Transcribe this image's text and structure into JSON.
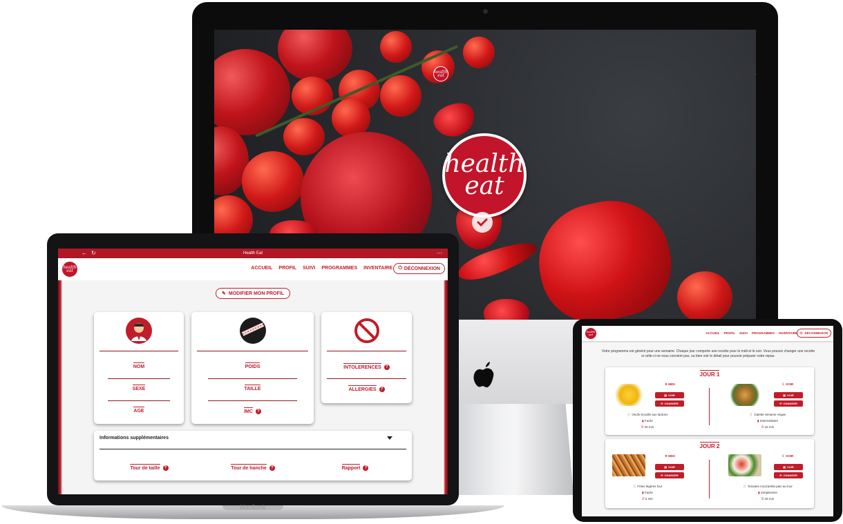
{
  "brand": {
    "logo_line1": "health",
    "logo_line2": "eat",
    "accent": "#c11c2a"
  },
  "nav": {
    "items": [
      "ACCUEIL",
      "PROFIL",
      "SUIVI",
      "PROGRAMMES",
      "INVENTAIRE"
    ],
    "logout_label": "DÉCONNEXION"
  },
  "macbook": {
    "window_title": "Health Eat",
    "brand_label": "MacBook",
    "edit_profile_label": "MODIFIER MON PROFIL",
    "identity_fields": [
      "NOM",
      "SEXE",
      "AGE"
    ],
    "body_fields": [
      "POIDS",
      "TAILLE",
      "IMC"
    ],
    "diet_fields": [
      "INTOLERENCES",
      "ALLERGIES"
    ],
    "extra_title": "Informations supplémentaires",
    "extra_fields": [
      "Tour de taille",
      "Tour de hanche",
      "Rapport"
    ],
    "help_icon": "?"
  },
  "ipad": {
    "intro": "Votre programme est généré pour une semaine. Chaque jour comporte une recette pour le midi et le soir. Vous pouvez changer une recette si celle-ci ne vous convient pas, ou bien voir le détail pour pouvoir préparer votre repas.",
    "view_label": "VOIR",
    "change_label": "CHANGER",
    "days": [
      {
        "title": "JOUR 1",
        "midi": {
          "label": "MIDI",
          "name": "Oeufs brouillé aux lardons",
          "level": "Facile",
          "time": "30 min"
        },
        "soir": {
          "label": "SOIR",
          "name": "Galette Sésame Vegan",
          "level": "Intermédiaire",
          "time": "15 min"
        }
      },
      {
        "title": "JOUR 2",
        "midi": {
          "label": "MIDI",
          "name": "Frites légères four",
          "level": "Facile",
          "time": "5 min"
        },
        "soir": {
          "label": "SOIR",
          "name": "Tomates mozzarella pain au four",
          "level": "Simplissime",
          "time": "25 min"
        }
      }
    ]
  }
}
